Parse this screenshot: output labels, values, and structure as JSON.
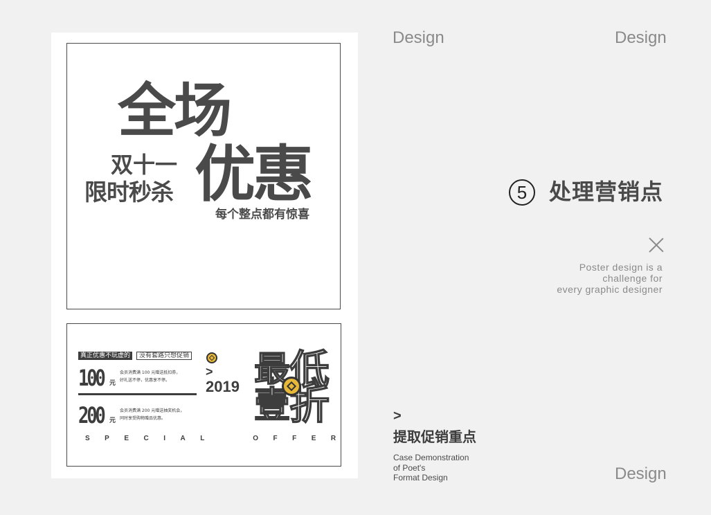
{
  "poster_top": {
    "line1": "全场",
    "line2a": "双十一",
    "line2b": "限时秒杀",
    "line3": "优惠",
    "line4": "每个整点都有惊喜"
  },
  "poster_bottom": {
    "tag_dark": "真正优惠不玩虚的",
    "tag_light": "没有套路只想促销",
    "amount1": "100",
    "unit1": "元",
    "desc1_line1": "会员消费满 100 元赠送抵扣券，",
    "desc1_line2": "好礼送不停，优惠享不停。",
    "amount2": "200",
    "unit2": "元",
    "desc2_line1": "会员消费满 200 元赠送抽奖机会，",
    "desc2_line2": "同时享受购物赠品优惠。",
    "arrow": ">",
    "year": "2019",
    "char_zui": "最",
    "char_di": "低",
    "char_yi": "壹",
    "char_zhe": "折",
    "special": "SPECIAL  OFFER"
  },
  "right": {
    "design_top_left": "Design",
    "design_top_right": "Design",
    "design_bottom_right": "Design",
    "step_number": "5",
    "step_title": "处理营销点",
    "note_line1": "Poster design is a",
    "note_line2": "challenge for",
    "note_line3": "every graphic designer",
    "arrow": ">",
    "extract_title": "提取促销重点",
    "case_line1": "Case Demonstration",
    "case_line2": "of Poet's",
    "case_line3": "Format Design"
  },
  "colors": {
    "background": "#f1f1f1",
    "text_dark": "#4a4a4a",
    "text_light": "#8a8a8a",
    "coin_gold": "#e8b83a"
  }
}
